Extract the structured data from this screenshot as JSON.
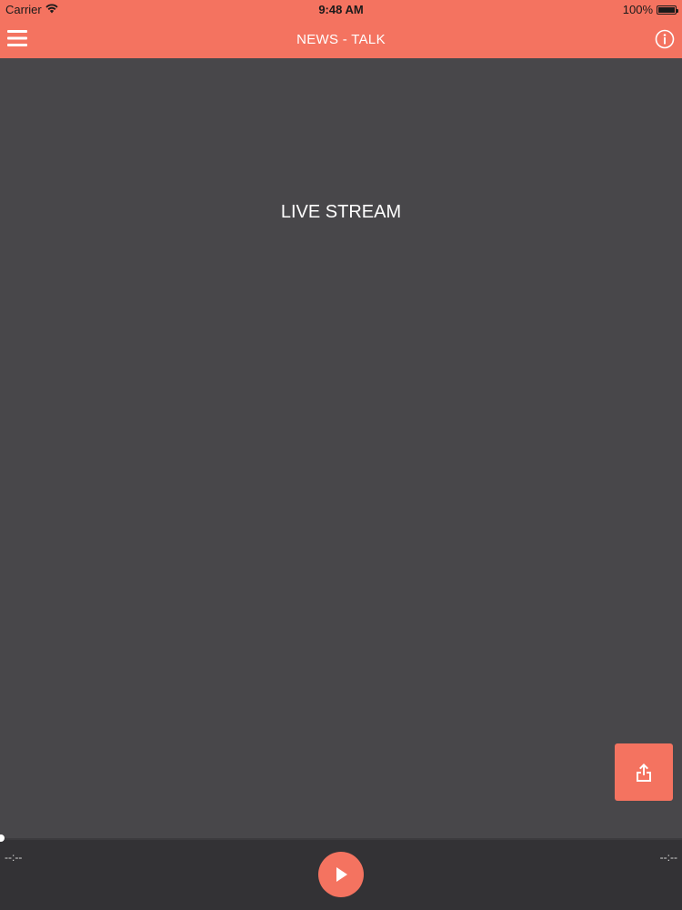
{
  "status_bar": {
    "carrier": "Carrier",
    "time": "9:48 AM",
    "battery": "100%",
    "wifi_icon": "wifi-icon",
    "battery_icon": "battery-icon",
    "battery_level": 1.0
  },
  "nav": {
    "title": "NEWS - TALK",
    "menu_icon": "hamburger-menu-icon",
    "info_icon": "info-icon"
  },
  "main": {
    "stream_label": "LIVE STREAM",
    "share_icon": "share-icon"
  },
  "player": {
    "elapsed": "--:--",
    "remaining": "--:--",
    "progress": 0,
    "play_icon": "play-icon"
  },
  "colors": {
    "accent": "#f47360",
    "background": "#48474a",
    "player_background": "#333235",
    "text": "#ffffff"
  }
}
